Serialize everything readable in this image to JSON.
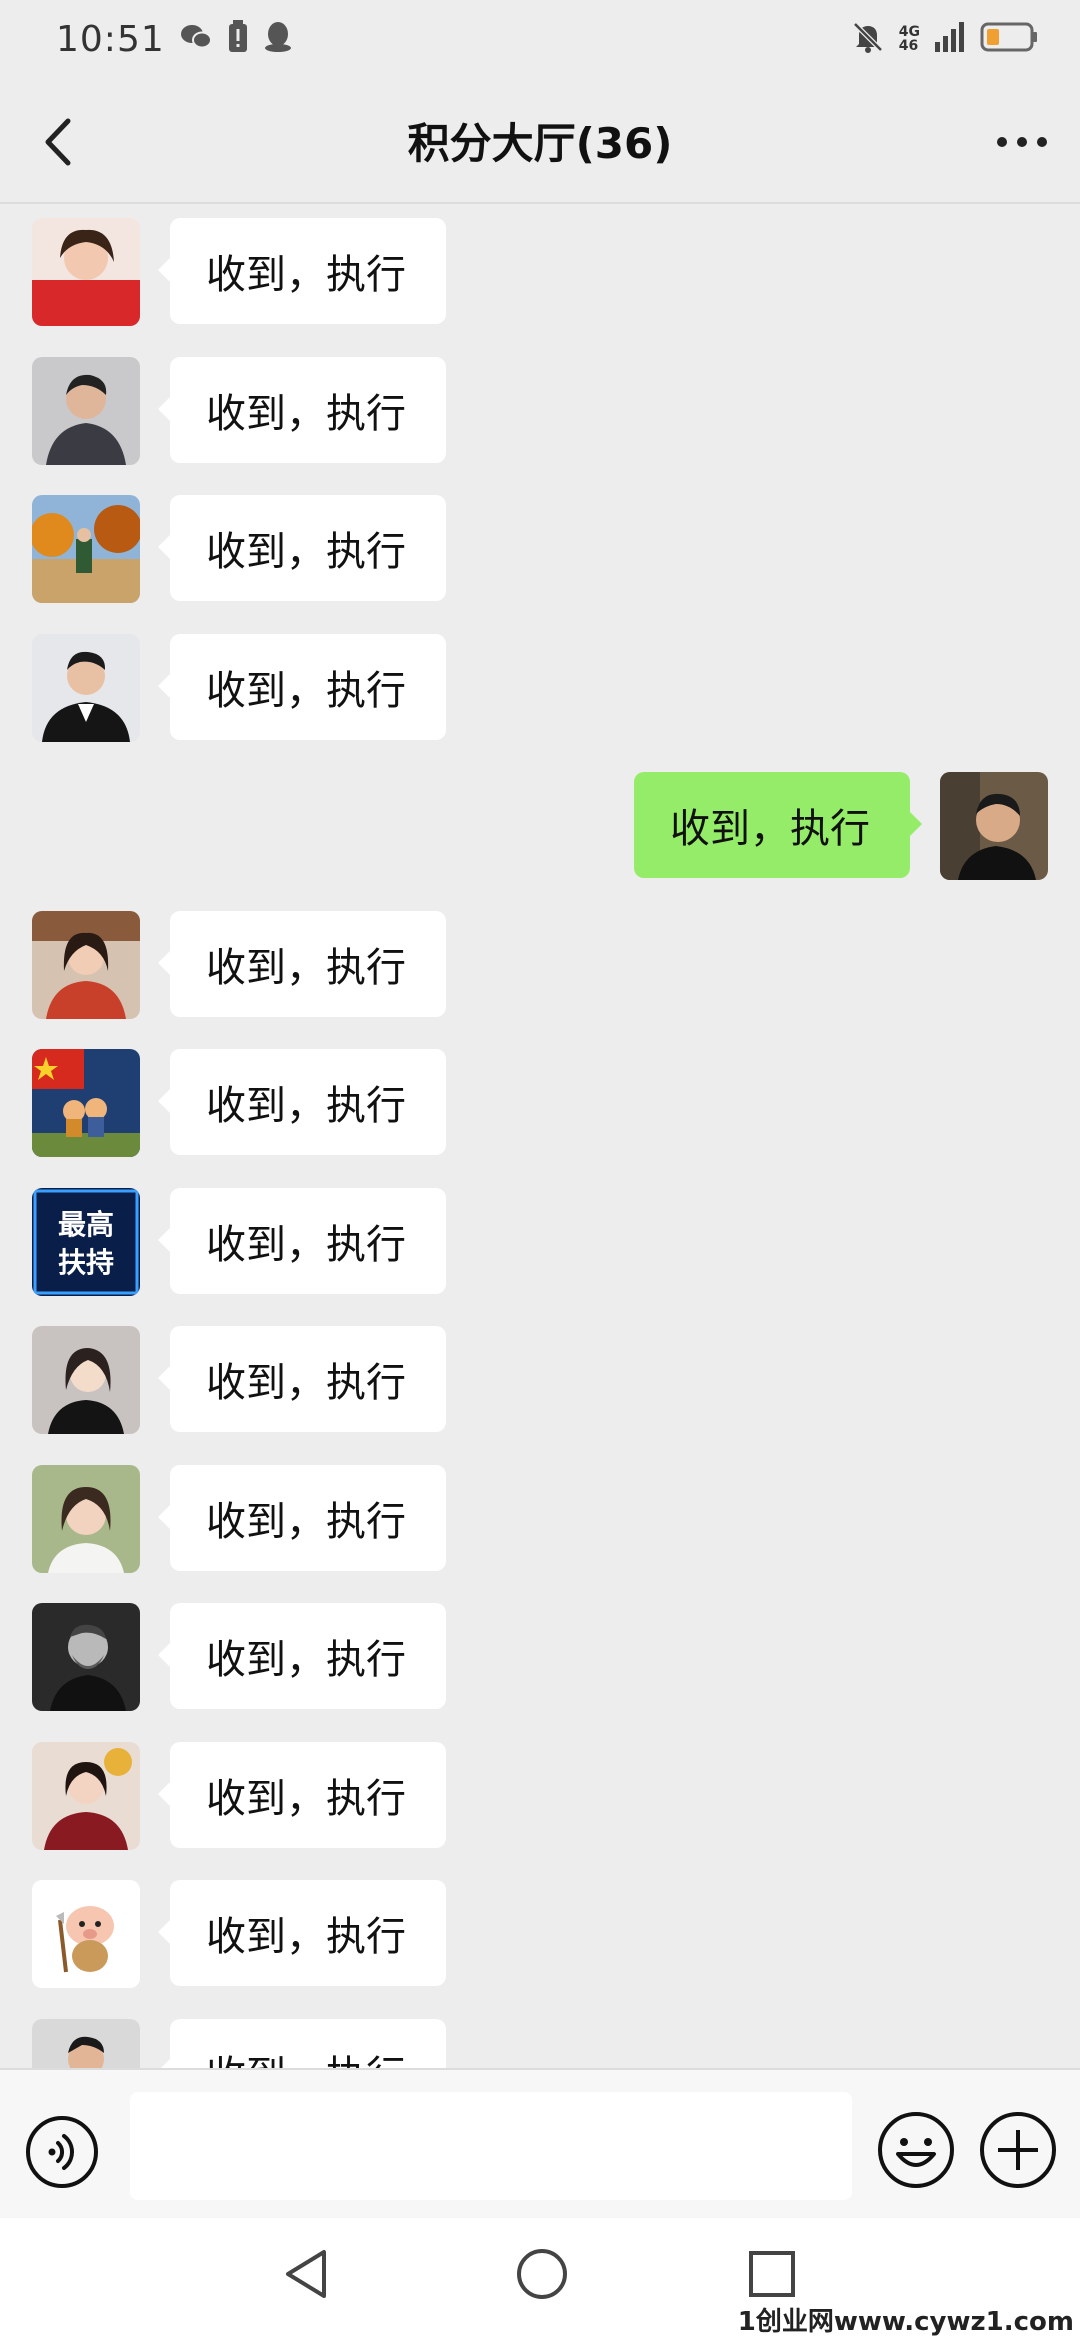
{
  "status_bar": {
    "time": "10:51",
    "network_top": "4G",
    "network_bottom": "46"
  },
  "header": {
    "title": "积分大厅(36)"
  },
  "messages": [
    {
      "side": "left",
      "text": "收到，执行",
      "avatar": "avatar-woman-red"
    },
    {
      "side": "left",
      "text": "收到，执行",
      "avatar": "avatar-man-suit-grey"
    },
    {
      "side": "left",
      "text": "收到，执行",
      "avatar": "avatar-autumn-scene"
    },
    {
      "side": "left",
      "text": "收到，执行",
      "avatar": "avatar-man-black-suit"
    },
    {
      "side": "right",
      "text": "收到，执行",
      "avatar": "avatar-self"
    },
    {
      "side": "left",
      "text": "收到，执行",
      "avatar": "avatar-woman-bookshelf"
    },
    {
      "side": "left",
      "text": "收到，执行",
      "avatar": "avatar-flag-kids"
    },
    {
      "side": "left",
      "text": "收到，执行",
      "avatar": "avatar-text-badge",
      "avatar_text": [
        "最高",
        "扶持"
      ]
    },
    {
      "side": "left",
      "text": "收到，执行",
      "avatar": "avatar-woman-dark"
    },
    {
      "side": "left",
      "text": "收到，执行",
      "avatar": "avatar-woman-light"
    },
    {
      "side": "left",
      "text": "收到，执行",
      "avatar": "avatar-man-bw"
    },
    {
      "side": "left",
      "text": "收到，执行",
      "avatar": "avatar-woman-red-coat"
    },
    {
      "side": "left",
      "text": "收到，执行",
      "avatar": "avatar-cartoon"
    },
    {
      "side": "left",
      "text": "收到，执行",
      "avatar": "avatar-man-partial"
    }
  ],
  "input_bar": {
    "placeholder": ""
  },
  "watermark": "1创业网www.cywz1.com",
  "colors": {
    "background": "#ededed",
    "self_bubble": "#95ec69",
    "other_bubble": "#ffffff"
  }
}
